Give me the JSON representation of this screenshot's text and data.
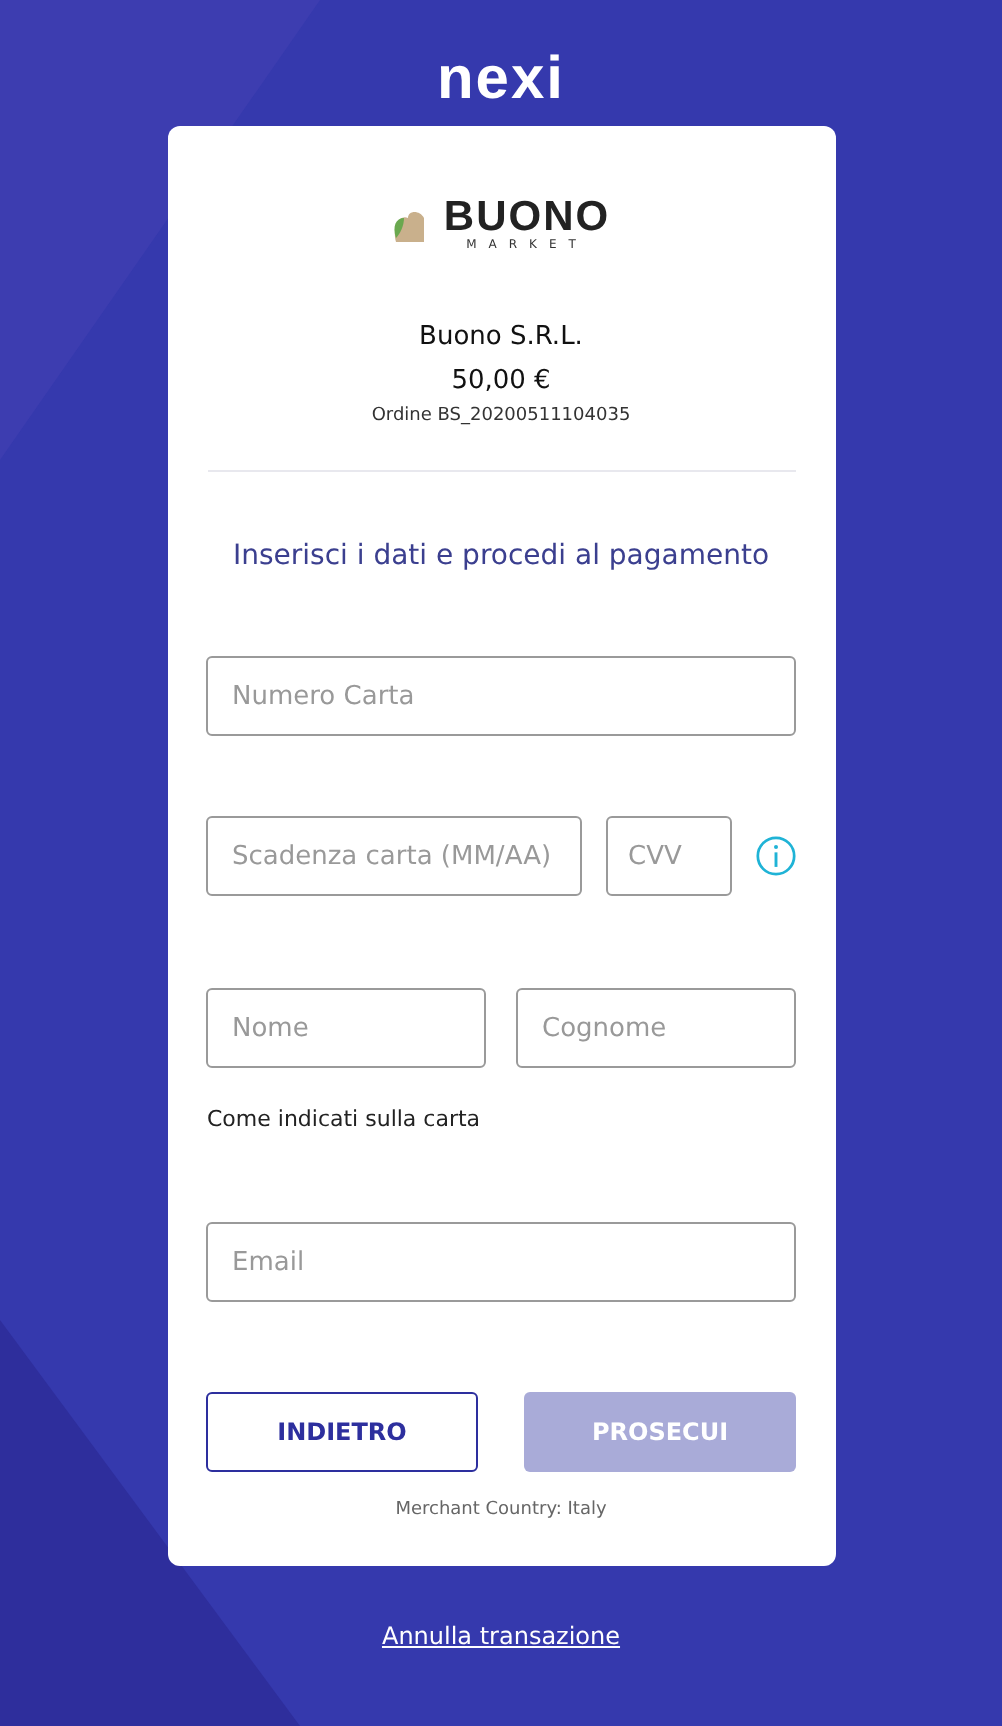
{
  "brand": "nexi",
  "merchant": {
    "logo_word": "BUONO",
    "logo_sub": "MARKET",
    "name": "Buono S.R.L.",
    "amount": "50,00 €",
    "order": "Ordine BS_20200511104035"
  },
  "heading": "Inserisci i dati e procedi al pagamento",
  "fields": {
    "card_number": {
      "placeholder": "Numero Carta"
    },
    "expiry": {
      "placeholder": "Scadenza carta (MM/AA)"
    },
    "cvv": {
      "placeholder": "CVV"
    },
    "first_name": {
      "placeholder": "Nome"
    },
    "last_name": {
      "placeholder": "Cognome"
    },
    "email": {
      "placeholder": "Email"
    }
  },
  "name_hint": "Come indicati sulla carta",
  "buttons": [
    {
      "label": "INDIETRO",
      "kind": "outline",
      "disabled": false
    },
    {
      "label": "PROSECUI",
      "kind": "primary",
      "disabled": true
    }
  ],
  "merchant_country": "Merchant Country: Italy",
  "cancel_link": "Annulla transazione"
}
